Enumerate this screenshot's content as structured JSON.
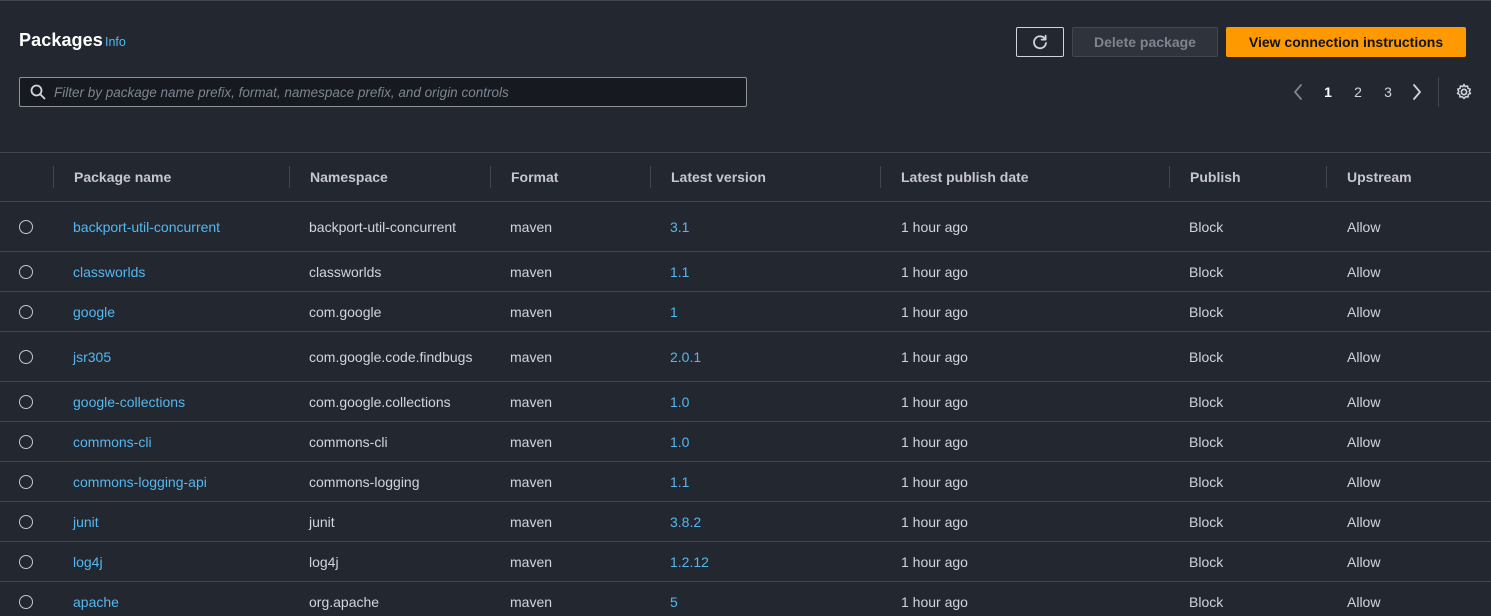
{
  "header": {
    "title": "Packages",
    "info_label": "Info",
    "refresh_icon": "refresh-icon",
    "delete_label": "Delete package",
    "primary_label": "View connection instructions"
  },
  "search": {
    "placeholder": "Filter by package name prefix, format, namespace prefix, and origin controls",
    "value": ""
  },
  "pagination": {
    "pages": [
      "1",
      "2",
      "3"
    ],
    "current": "1",
    "prev_icon": "chevron-left-icon",
    "next_icon": "chevron-right-icon",
    "settings_icon": "gear-icon"
  },
  "table": {
    "columns": [
      "Package name",
      "Namespace",
      "Format",
      "Latest version",
      "Latest publish date",
      "Publish",
      "Upstream"
    ],
    "rows": [
      {
        "name": "backport-util-concurrent",
        "namespace": "backport-util-concurrent",
        "format": "maven",
        "version": "3.1",
        "date": "1 hour ago",
        "publish": "Block",
        "upstream": "Allow"
      },
      {
        "name": "classworlds",
        "namespace": "classworlds",
        "format": "maven",
        "version": "1.1",
        "date": "1 hour ago",
        "publish": "Block",
        "upstream": "Allow"
      },
      {
        "name": "google",
        "namespace": "com.google",
        "format": "maven",
        "version": "1",
        "date": "1 hour ago",
        "publish": "Block",
        "upstream": "Allow"
      },
      {
        "name": "jsr305",
        "namespace": "com.google.code.findbugs",
        "format": "maven",
        "version": "2.0.1",
        "date": "1 hour ago",
        "publish": "Block",
        "upstream": "Allow"
      },
      {
        "name": "google-collections",
        "namespace": "com.google.collections",
        "format": "maven",
        "version": "1.0",
        "date": "1 hour ago",
        "publish": "Block",
        "upstream": "Allow"
      },
      {
        "name": "commons-cli",
        "namespace": "commons-cli",
        "format": "maven",
        "version": "1.0",
        "date": "1 hour ago",
        "publish": "Block",
        "upstream": "Allow"
      },
      {
        "name": "commons-logging-api",
        "namespace": "commons-logging",
        "format": "maven",
        "version": "1.1",
        "date": "1 hour ago",
        "publish": "Block",
        "upstream": "Allow"
      },
      {
        "name": "junit",
        "namespace": "junit",
        "format": "maven",
        "version": "3.8.2",
        "date": "1 hour ago",
        "publish": "Block",
        "upstream": "Allow"
      },
      {
        "name": "log4j",
        "namespace": "log4j",
        "format": "maven",
        "version": "1.2.12",
        "date": "1 hour ago",
        "publish": "Block",
        "upstream": "Allow"
      },
      {
        "name": "apache",
        "namespace": "org.apache",
        "format": "maven",
        "version": "5",
        "date": "1 hour ago",
        "publish": "Block",
        "upstream": "Allow"
      }
    ]
  },
  "colors": {
    "background": "#232730",
    "link": "#54b8f0",
    "primary": "#ff9900",
    "border": "#414750"
  }
}
